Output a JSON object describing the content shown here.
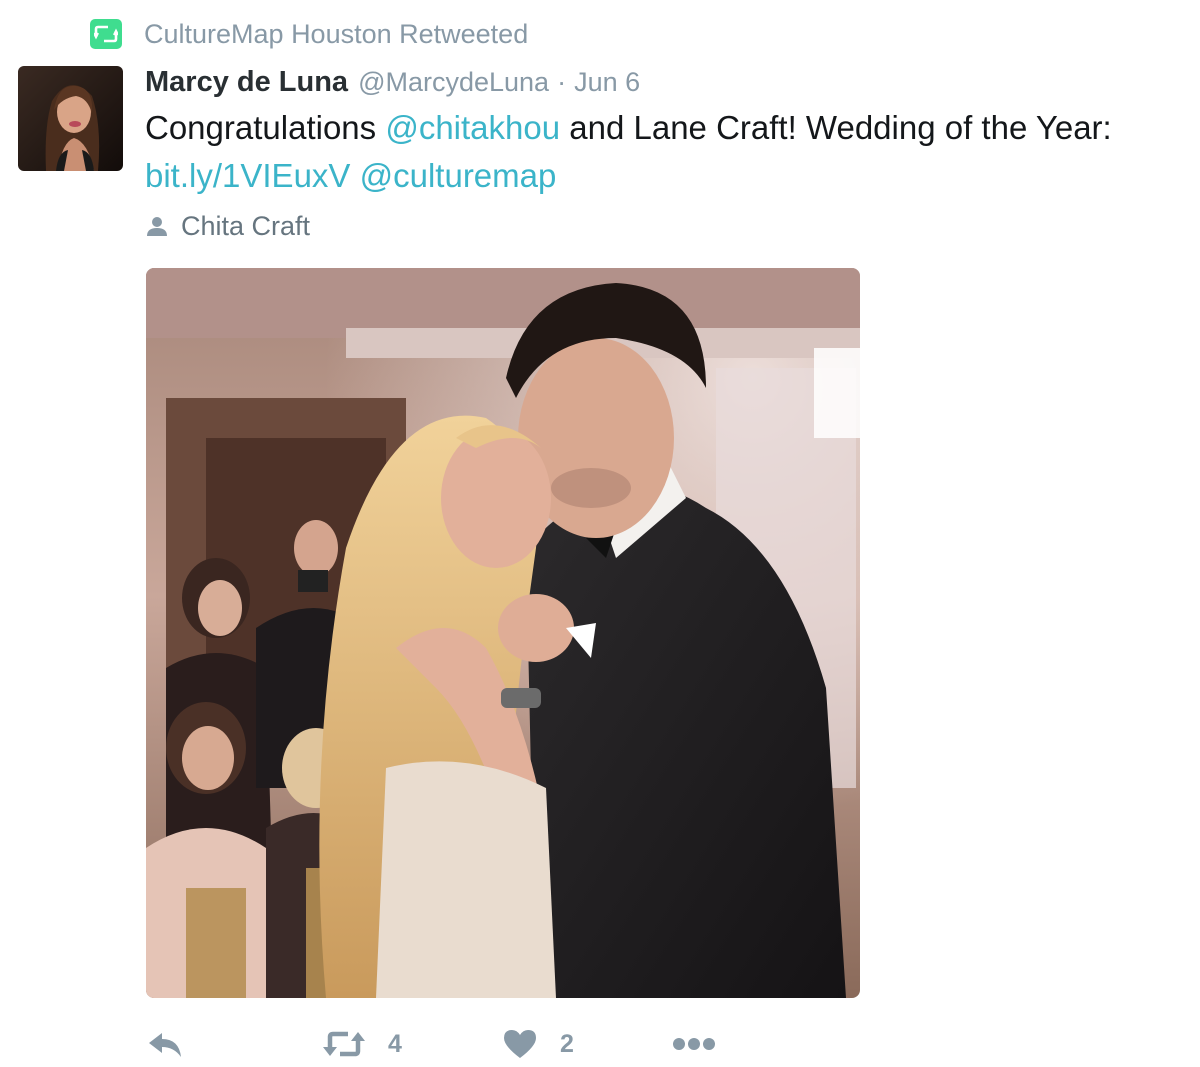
{
  "retweet_context": {
    "icon": "retweet-icon",
    "text": "CultureMap Houston Retweeted"
  },
  "author": {
    "fullname": "Marcy de Luna",
    "username": "@MarcydeLuna",
    "separator": "·",
    "timestamp": "Jun 6"
  },
  "tweet": {
    "text_part1": "Congratulations ",
    "mention1": "@chitakhou",
    "text_part2": " and Lane Craft! Wedding of the Year:",
    "link": "bit.ly/1VIEuxV",
    "text_part3": " ",
    "mention2": "@culturemap"
  },
  "place": {
    "icon": "person-icon",
    "label": "Chita Craft"
  },
  "actions": {
    "reply_icon": "reply-icon",
    "retweet_icon": "retweet-icon",
    "retweet_count": "4",
    "like_icon": "heart-icon",
    "like_count": "2",
    "more_icon": "more-dots-icon"
  },
  "colors": {
    "link": "#3bb4c9",
    "retweet_badge": "#3fdd8f",
    "muted": "#8899a6"
  }
}
